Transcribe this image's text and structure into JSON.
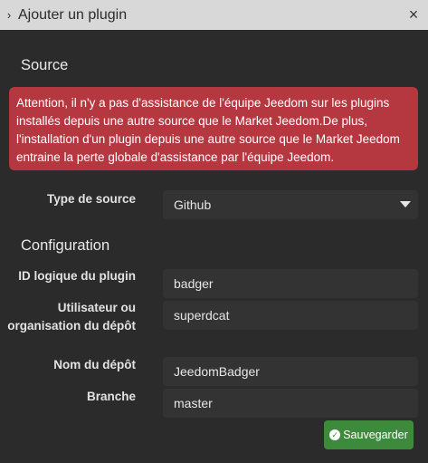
{
  "dialog": {
    "title": "Ajouter un plugin",
    "close_symbol": "×",
    "expand_symbol": "›"
  },
  "source": {
    "heading": "Source",
    "warning": "Attention, il n'y a pas d'assistance de l'équipe Jeedom sur les plugins installés depuis une autre source que le Market Jeedom.De plus, l'installation d'un plugin depuis une autre source que le Market Jeedom entraine la perte globale d'assistance par l'équipe Jeedom.",
    "type_label": "Type de source",
    "type_value": "Github"
  },
  "configuration": {
    "heading": "Configuration",
    "fields": [
      {
        "label": "ID logique du plugin",
        "value": "badger"
      },
      {
        "label": "Utilisateur ou organisation du dépôt",
        "value": "superdcat"
      },
      {
        "label": "Nom du dépôt",
        "value": "JeedomBadger"
      },
      {
        "label": "Branche",
        "value": "master"
      }
    ]
  },
  "actions": {
    "save_label": "Sauvegarder",
    "save_icon": "check-circle-icon",
    "save_color": "#3d8a3d"
  },
  "colors": {
    "alert_bg": "#b5373f",
    "background": "#2b2b2b",
    "titlebar_bg": "#d8d8d8"
  }
}
